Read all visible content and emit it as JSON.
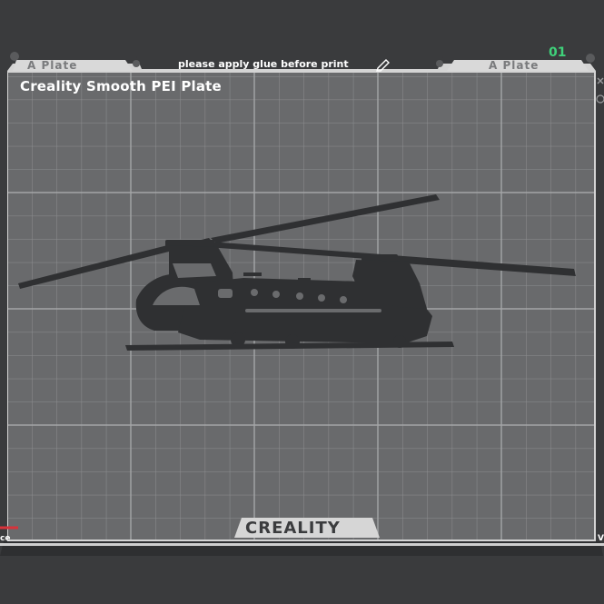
{
  "bed": {
    "plate_name": "Creality Smooth PEI Plate",
    "glue_note": "please apply glue before print",
    "tab_left_label": "A Plate",
    "tab_right_label": "A Plate",
    "plate_index": "01",
    "brand": "CREALITY"
  },
  "model": {
    "object": "helicopter-silhouette",
    "color": "#2f3032"
  },
  "edge_labels": {
    "left": "ce",
    "right": "V"
  },
  "colors": {
    "background": "#3a3b3d",
    "bed_surface": "#6a6b6d",
    "grid_line": "#8b8c8e",
    "frame": "#c9c9c9",
    "index_accent": "#3fd17a"
  }
}
